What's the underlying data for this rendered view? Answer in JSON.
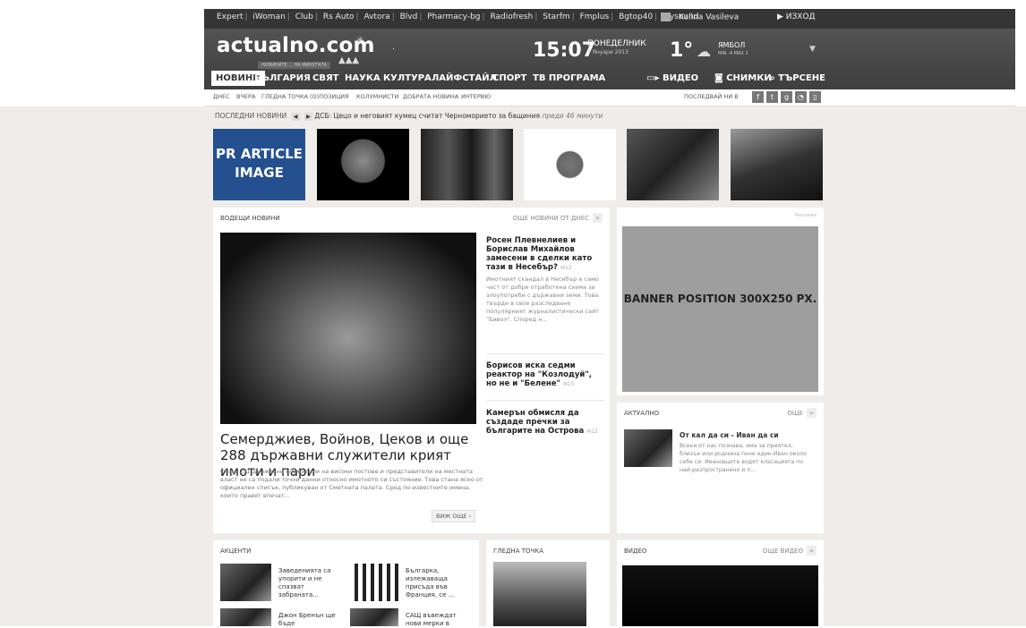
{
  "top_links": [
    "Expert",
    "iWoman",
    "Club",
    "Rs Auto",
    "Avtora",
    "Blvd",
    "Pharmacy-bg",
    "Radiofresh",
    "Starfm",
    "Fmplus",
    "Bgtop40",
    "Mysound"
  ],
  "user": {
    "name": "Kalina Vasileva",
    "logout": "ИЗХОД"
  },
  "logo": {
    "text": "actualno.com",
    "tagline": "НОВИНИТЕ ... НА МИНУТАТА"
  },
  "clock": {
    "time": "15:07",
    "day": "ПОНЕДЕЛНИК",
    "date": "7 Януари 2013"
  },
  "weather": {
    "temp": "1°",
    "city": "ЯМБОЛ",
    "sub": "MIN -4   MAX 1",
    "icon": "snow-cloud-icon"
  },
  "nav": {
    "items": [
      "НОВИНИ",
      "БЪЛГАРИЯ",
      "СВЯТ",
      "НАУКА",
      "КУЛТУРА",
      "ЛАЙФСТАЙЛ",
      "СПОРТ",
      "ТВ ПРОГРАМА"
    ],
    "video": "ВИДЕО",
    "photos": "СНИМКИ",
    "search": "ТЪРСЕНЕ"
  },
  "subnav": {
    "items": [
      "ДНЕС",
      "ВЧЕРА",
      "ГЛЕДНА ТОЧКА",
      "(О)ПОЗИЦИЯ",
      "КОЛУМНИСТИ",
      "ДОБРАТА НОВИНА",
      "ИНТЕРВЮ"
    ],
    "follow": "ПОСЛЕДВАЙ НИ В",
    "social": [
      "f",
      "t",
      "g+",
      "rss",
      "m"
    ]
  },
  "ticker": {
    "label": "ПОСЛЕДНИ НОВИНИ",
    "text": "ДСБ: Цецо и неговият кумец считат Черноморието за бащиния",
    "time": "преди 46 минути"
  },
  "strip": {
    "pr_label": "PR ARTICLE IMAGE"
  },
  "lead_news": {
    "title": "ВОДЕЩИ НОВИНИ",
    "more": "ОЩЕ НОВИНИ ОТ ДНЕС",
    "main_headline": "Семерджиев, Войнов, Цеков и още 288 държавни служители крият имоти и пари",
    "main_lead": "Общо 291 държавни служители на високи постове и представители на местната власт не са подали точни данни относно имотното си състояние. Това стана ясно от официален списък, публикуван от Сметната палата. Сред по-известните имена, които правят впечат...",
    "more_button": "ВИЖ ОЩЕ",
    "side": [
      {
        "title": "Росен Плевнелиев и Борислав Михайлов замесени в сделки като тази в Несебър?",
        "comments": "12",
        "desc": "Имотният скандал в Несебър е само част от добре отработена схема за злоупотреби с държавни земи. Това твърди в свое разследване популярният журналистически сайт \"Бивол\". Според н..."
      },
      {
        "title": "Борисов иска седми реактор на \"Козлодуй\", но не и \"Белене\"",
        "comments": "15",
        "desc": ""
      },
      {
        "title": "Камерън обмисля да създаде пречки за българите на Острова",
        "comments": "12",
        "desc": ""
      }
    ]
  },
  "banner": {
    "ads_label": "Реклама",
    "text": "BANNER POSITION 300X250 PX."
  },
  "aktualno": {
    "title": "АКТУАЛНО",
    "more": "ОЩЕ",
    "item_title": "От кал да си - Иван да си",
    "item_desc": "Всеки от нас познава, има за приятел, близък или роднина поне един Иван около себе си. Ивановците водят класацията по най-разпространено и п..."
  },
  "akcenti": {
    "title": "АКЦЕНТИ",
    "items": [
      "Заведенията са упорити и не спазват забраната...",
      "Българка, излежаваща присъда във Франция, се ...",
      "Джон Бренън ще бъде",
      "САЩ въвеждат нови мерки в"
    ]
  },
  "gledna": {
    "title": "ГЛЕДНА ТОЧКА"
  },
  "video": {
    "title": "ВИДЕО",
    "more": "ОЩЕ ВИДЕО"
  }
}
